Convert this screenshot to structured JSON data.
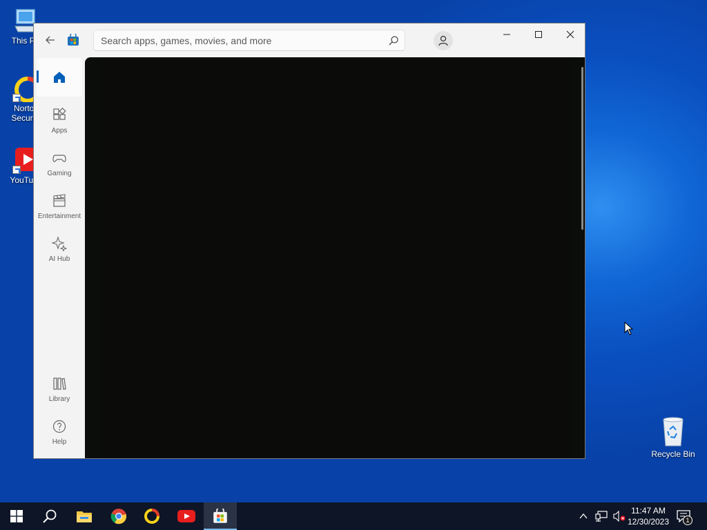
{
  "desktop": {
    "icons": [
      {
        "label": "This PC"
      },
      {
        "label": "Norton Security"
      },
      {
        "label": "YouTube"
      }
    ],
    "recycle_bin": {
      "label": "Recycle Bin"
    }
  },
  "store_window": {
    "search": {
      "placeholder": "Search apps, games, movies, and more",
      "value": ""
    },
    "nav_items": [
      {
        "label": "",
        "icon": "home-icon",
        "active": true
      },
      {
        "label": "Apps",
        "icon": "apps-icon"
      },
      {
        "label": "Gaming",
        "icon": "gamepad-icon"
      },
      {
        "label": "Entertainment",
        "icon": "clapperboard-icon"
      },
      {
        "label": "AI Hub",
        "icon": "sparkle-icon"
      },
      {
        "label": "Library",
        "icon": "library-icon"
      },
      {
        "label": "Help",
        "icon": "help-icon"
      }
    ]
  },
  "taskbar": {
    "apps": [
      "start",
      "search",
      "file-explorer",
      "chrome",
      "norton",
      "youtube",
      "microsoft-store"
    ],
    "active_app": "microsoft-store",
    "clock": {
      "time": "11:47 AM",
      "date": "12/30/2023"
    },
    "notification_count": "1"
  },
  "colors": {
    "accent": "#005fb8",
    "taskbar": "#0e1526",
    "content_bg": "#0a0d0a"
  }
}
